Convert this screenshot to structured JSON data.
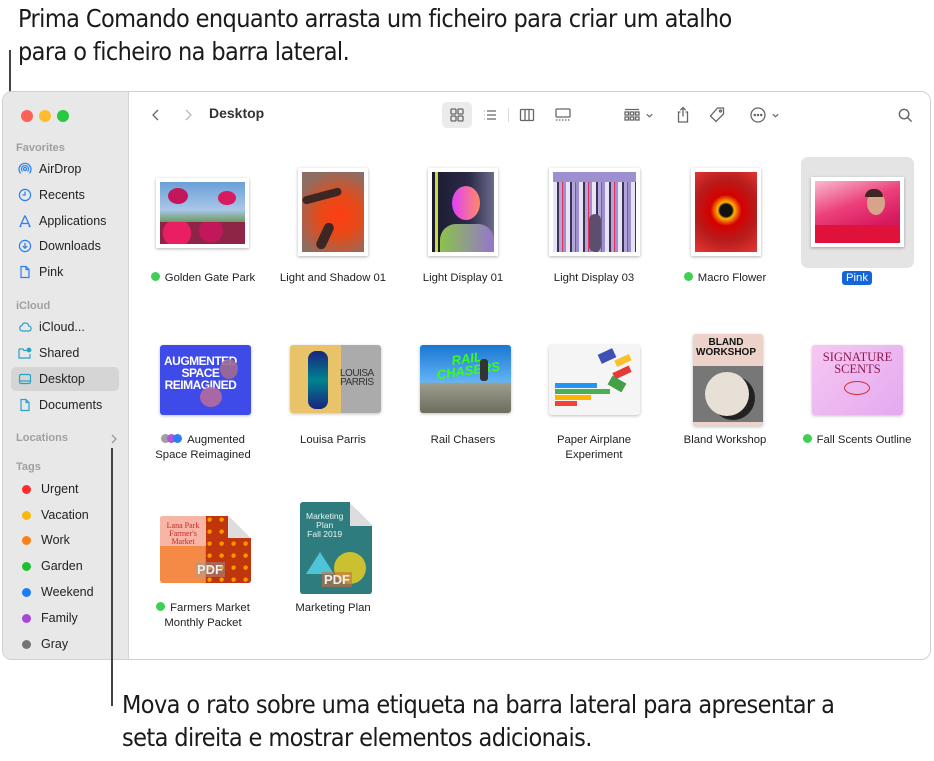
{
  "callouts": {
    "top": "Prima Comando enquanto arrasta um ficheiro para criar um atalho para o ficheiro na barra lateral.",
    "bottom": "Mova o rato sobre uma etiqueta na barra lateral para apresentar a seta direita e mostrar elementos adicionais."
  },
  "window": {
    "traffic_lights": {
      "close": "#fe5f57",
      "minimize": "#febc2e",
      "zoom": "#28c840"
    }
  },
  "sidebar": {
    "sections": {
      "favorites": "Favorites",
      "icloud": "iCloud",
      "locations": "Locations",
      "tags": "Tags"
    },
    "favorites": [
      {
        "label": "AirDrop",
        "icon": "airdrop-icon"
      },
      {
        "label": "Recents",
        "icon": "clock-icon"
      },
      {
        "label": "Applications",
        "icon": "applications-icon"
      },
      {
        "label": "Downloads",
        "icon": "download-icon"
      },
      {
        "label": "Pink",
        "icon": "document-icon"
      }
    ],
    "icloud": [
      {
        "label": "iCloud...",
        "icon": "cloud-icon"
      },
      {
        "label": "Shared",
        "icon": "shared-folder-icon"
      },
      {
        "label": "Desktop",
        "icon": "desktop-icon",
        "selected": true
      },
      {
        "label": "Documents",
        "icon": "document-icon"
      }
    ],
    "locations_expand_icon": "chevron-right-icon",
    "tags": [
      {
        "label": "Urgent",
        "color": "#fe2d2d"
      },
      {
        "label": "Vacation",
        "color": "#fbb80a"
      },
      {
        "label": "Work",
        "color": "#fd7f16"
      },
      {
        "label": "Garden",
        "color": "#1cc133"
      },
      {
        "label": "Weekend",
        "color": "#1a7cf7"
      },
      {
        "label": "Family",
        "color": "#a845da"
      },
      {
        "label": "Gray",
        "color": "#737378"
      }
    ]
  },
  "toolbar": {
    "title": "Desktop",
    "view_mode": "icon",
    "buttons": [
      "back",
      "forward",
      "icon-view",
      "list-view",
      "column-view",
      "gallery-view",
      "group",
      "share",
      "tag",
      "more",
      "search"
    ]
  },
  "files": [
    {
      "name": "Golden Gate Park",
      "tag": "#3fcf55"
    },
    {
      "name": "Light and Shadow 01"
    },
    {
      "name": "Light Display 01"
    },
    {
      "name": "Light Display 03"
    },
    {
      "name": "Macro Flower",
      "tag": "#3fcf55"
    },
    {
      "name": "Pink",
      "selected": true
    },
    {
      "name": "Augmented Space Reimagined",
      "line1": "Augmented",
      "line2": "Space Reimagined",
      "multi_tags": [
        "#9e9ea3",
        "#b553e0",
        "#2b7ff0"
      ]
    },
    {
      "name": "Louisa Parris"
    },
    {
      "name": "Rail Chasers"
    },
    {
      "name": "Paper Airplane Experiment",
      "line1": "Paper Airplane",
      "line2": "Experiment"
    },
    {
      "name": "Bland Workshop"
    },
    {
      "name": "Fall Scents Outline",
      "tag": "#3fcf55"
    },
    {
      "name": "Farmers Market Monthly Packet",
      "line1": "Farmers Market",
      "line2": "Monthly Packet",
      "tag": "#3fcf55"
    },
    {
      "name": "Marketing Plan"
    }
  ],
  "thumb_text": {
    "augmented": [
      "AUGMENTED",
      "SPACE",
      "REIMAGINED"
    ],
    "louisa": [
      "LOUISA",
      "PARRIS"
    ],
    "rail": "RAIL CHASERS",
    "bland": [
      "BLAND",
      "WORKSHOP"
    ],
    "scents": [
      "SIGNATURE",
      "SCENTS"
    ],
    "farmers": [
      "Lana Park",
      "Farmer's Market"
    ],
    "marketing": [
      "Marketing",
      "Plan",
      "Fall 2019"
    ],
    "pdf": "PDF"
  }
}
